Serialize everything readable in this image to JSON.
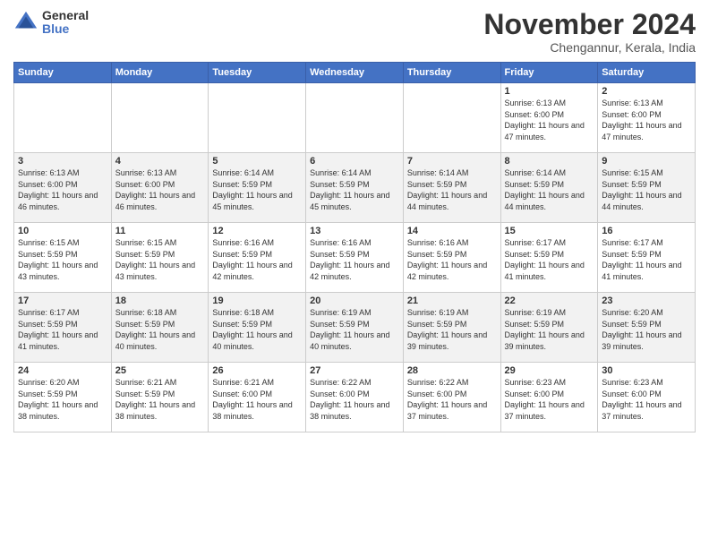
{
  "logo": {
    "general": "General",
    "blue": "Blue"
  },
  "title": "November 2024",
  "location": "Chengannur, Kerala, India",
  "days_header": [
    "Sunday",
    "Monday",
    "Tuesday",
    "Wednesday",
    "Thursday",
    "Friday",
    "Saturday"
  ],
  "weeks": [
    [
      {
        "day": "",
        "info": ""
      },
      {
        "day": "",
        "info": ""
      },
      {
        "day": "",
        "info": ""
      },
      {
        "day": "",
        "info": ""
      },
      {
        "day": "",
        "info": ""
      },
      {
        "day": "1",
        "info": "Sunrise: 6:13 AM\nSunset: 6:00 PM\nDaylight: 11 hours\nand 47 minutes."
      },
      {
        "day": "2",
        "info": "Sunrise: 6:13 AM\nSunset: 6:00 PM\nDaylight: 11 hours\nand 47 minutes."
      }
    ],
    [
      {
        "day": "3",
        "info": "Sunrise: 6:13 AM\nSunset: 6:00 PM\nDaylight: 11 hours\nand 46 minutes."
      },
      {
        "day": "4",
        "info": "Sunrise: 6:13 AM\nSunset: 6:00 PM\nDaylight: 11 hours\nand 46 minutes."
      },
      {
        "day": "5",
        "info": "Sunrise: 6:14 AM\nSunset: 5:59 PM\nDaylight: 11 hours\nand 45 minutes."
      },
      {
        "day": "6",
        "info": "Sunrise: 6:14 AM\nSunset: 5:59 PM\nDaylight: 11 hours\nand 45 minutes."
      },
      {
        "day": "7",
        "info": "Sunrise: 6:14 AM\nSunset: 5:59 PM\nDaylight: 11 hours\nand 44 minutes."
      },
      {
        "day": "8",
        "info": "Sunrise: 6:14 AM\nSunset: 5:59 PM\nDaylight: 11 hours\nand 44 minutes."
      },
      {
        "day": "9",
        "info": "Sunrise: 6:15 AM\nSunset: 5:59 PM\nDaylight: 11 hours\nand 44 minutes."
      }
    ],
    [
      {
        "day": "10",
        "info": "Sunrise: 6:15 AM\nSunset: 5:59 PM\nDaylight: 11 hours\nand 43 minutes."
      },
      {
        "day": "11",
        "info": "Sunrise: 6:15 AM\nSunset: 5:59 PM\nDaylight: 11 hours\nand 43 minutes."
      },
      {
        "day": "12",
        "info": "Sunrise: 6:16 AM\nSunset: 5:59 PM\nDaylight: 11 hours\nand 42 minutes."
      },
      {
        "day": "13",
        "info": "Sunrise: 6:16 AM\nSunset: 5:59 PM\nDaylight: 11 hours\nand 42 minutes."
      },
      {
        "day": "14",
        "info": "Sunrise: 6:16 AM\nSunset: 5:59 PM\nDaylight: 11 hours\nand 42 minutes."
      },
      {
        "day": "15",
        "info": "Sunrise: 6:17 AM\nSunset: 5:59 PM\nDaylight: 11 hours\nand 41 minutes."
      },
      {
        "day": "16",
        "info": "Sunrise: 6:17 AM\nSunset: 5:59 PM\nDaylight: 11 hours\nand 41 minutes."
      }
    ],
    [
      {
        "day": "17",
        "info": "Sunrise: 6:17 AM\nSunset: 5:59 PM\nDaylight: 11 hours\nand 41 minutes."
      },
      {
        "day": "18",
        "info": "Sunrise: 6:18 AM\nSunset: 5:59 PM\nDaylight: 11 hours\nand 40 minutes."
      },
      {
        "day": "19",
        "info": "Sunrise: 6:18 AM\nSunset: 5:59 PM\nDaylight: 11 hours\nand 40 minutes."
      },
      {
        "day": "20",
        "info": "Sunrise: 6:19 AM\nSunset: 5:59 PM\nDaylight: 11 hours\nand 40 minutes."
      },
      {
        "day": "21",
        "info": "Sunrise: 6:19 AM\nSunset: 5:59 PM\nDaylight: 11 hours\nand 39 minutes."
      },
      {
        "day": "22",
        "info": "Sunrise: 6:19 AM\nSunset: 5:59 PM\nDaylight: 11 hours\nand 39 minutes."
      },
      {
        "day": "23",
        "info": "Sunrise: 6:20 AM\nSunset: 5:59 PM\nDaylight: 11 hours\nand 39 minutes."
      }
    ],
    [
      {
        "day": "24",
        "info": "Sunrise: 6:20 AM\nSunset: 5:59 PM\nDaylight: 11 hours\nand 38 minutes."
      },
      {
        "day": "25",
        "info": "Sunrise: 6:21 AM\nSunset: 5:59 PM\nDaylight: 11 hours\nand 38 minutes."
      },
      {
        "day": "26",
        "info": "Sunrise: 6:21 AM\nSunset: 6:00 PM\nDaylight: 11 hours\nand 38 minutes."
      },
      {
        "day": "27",
        "info": "Sunrise: 6:22 AM\nSunset: 6:00 PM\nDaylight: 11 hours\nand 38 minutes."
      },
      {
        "day": "28",
        "info": "Sunrise: 6:22 AM\nSunset: 6:00 PM\nDaylight: 11 hours\nand 37 minutes."
      },
      {
        "day": "29",
        "info": "Sunrise: 6:23 AM\nSunset: 6:00 PM\nDaylight: 11 hours\nand 37 minutes."
      },
      {
        "day": "30",
        "info": "Sunrise: 6:23 AM\nSunset: 6:00 PM\nDaylight: 11 hours\nand 37 minutes."
      }
    ]
  ]
}
